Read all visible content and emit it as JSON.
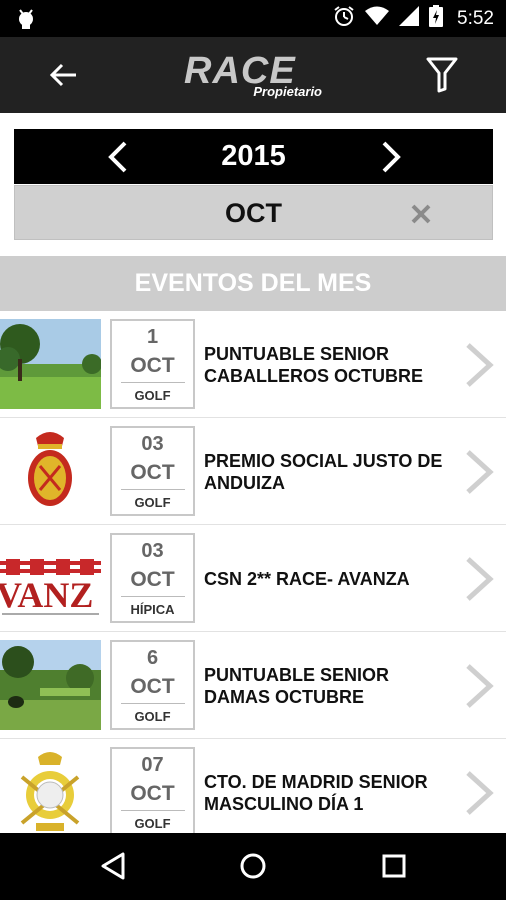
{
  "status_bar": {
    "time": "5:52",
    "icons": [
      "android-debug-icon",
      "alarm-icon",
      "wifi-icon",
      "signal-icon",
      "battery-icon"
    ]
  },
  "app_bar": {
    "logo_main": "RACE",
    "logo_sub": "Propietario",
    "back_icon": "back-arrow-icon",
    "filter_icon": "filter-icon"
  },
  "date_selector": {
    "year": "2015",
    "month": "OCT"
  },
  "section_header": "EVENTOS DEL MES",
  "events": [
    {
      "day": "1",
      "month": "OCT",
      "category": "GOLF",
      "title": "PUNTUABLE SENIOR CABALLEROS OCTUBRE",
      "thumb": "golf-course-thumb"
    },
    {
      "day": "03",
      "month": "OCT",
      "category": "GOLF",
      "title": "PREMIO SOCIAL JUSTO DE ANDUIZA",
      "thumb": "crest-thumb"
    },
    {
      "day": "03",
      "month": "OCT",
      "category": "HÍPICA",
      "title": "CSN 2** RACE- AVANZA",
      "thumb": "avanza-thumb"
    },
    {
      "day": "6",
      "month": "OCT",
      "category": "GOLF",
      "title": "PUNTUABLE SENIOR DAMAS OCTUBRE",
      "thumb": "golf-course-thumb-2"
    },
    {
      "day": "07",
      "month": "OCT",
      "category": "GOLF",
      "title": "CTO. DE MADRID SENIOR MASCULINO DÍA 1",
      "thumb": "golf-badge-thumb"
    }
  ],
  "colors": {
    "app_bar_bg": "#222222",
    "year_bar_bg": "#000000",
    "month_bar_bg": "#d0d0d0",
    "section_header_bg": "#cdcdcd"
  }
}
